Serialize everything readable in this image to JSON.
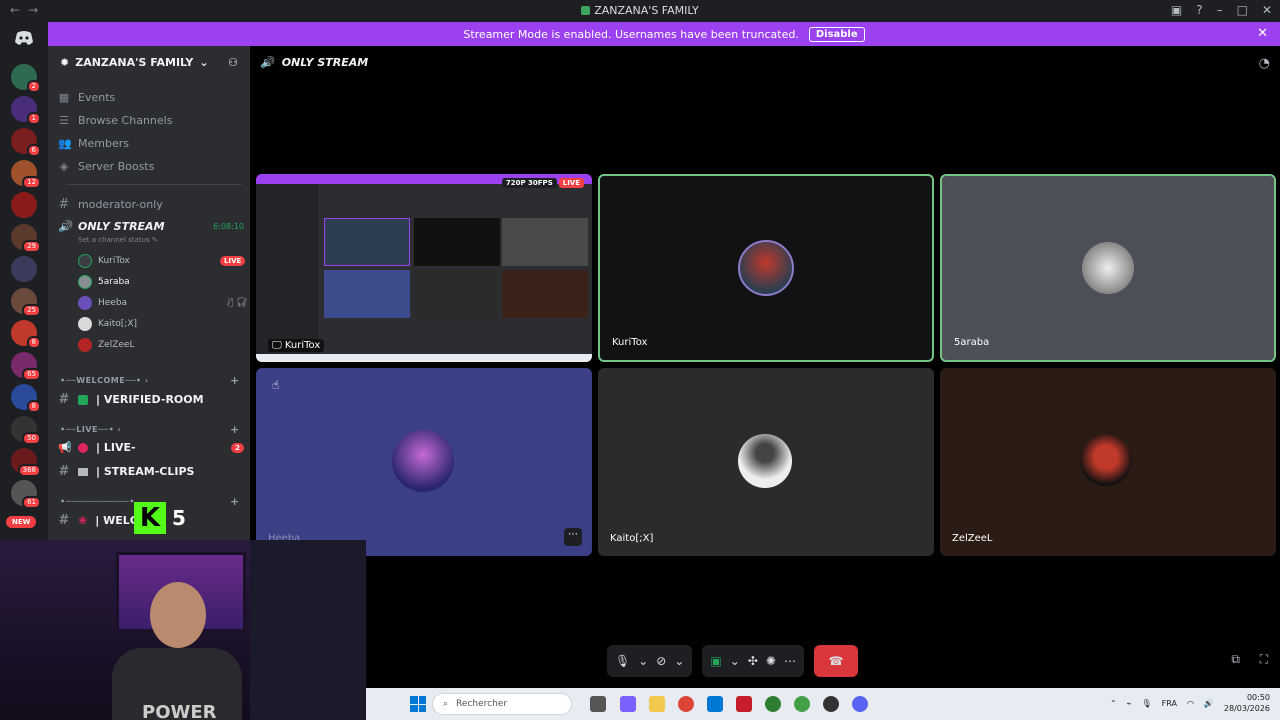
{
  "window": {
    "title": "ZANZANA'S FAMILY",
    "nav_back": "←",
    "nav_fwd": "→"
  },
  "banner": {
    "text": "Streamer Mode is enabled. Usernames have been truncated.",
    "disable_label": "Disable"
  },
  "guilds": {
    "badges": [
      "2",
      "1",
      "6",
      "12",
      "",
      "29",
      "",
      "25",
      "8",
      "65",
      "8",
      "50",
      "368",
      "61"
    ],
    "new_label": "NEW"
  },
  "server": {
    "name": "ZANZANA'S FAMILY",
    "menu": [
      {
        "label": "Events",
        "icon": "calendar-icon"
      },
      {
        "label": "Browse Channels",
        "icon": "browse-icon"
      },
      {
        "label": "Members",
        "icon": "members-icon"
      },
      {
        "label": "Server Boosts",
        "icon": "boost-icon"
      }
    ],
    "channels": {
      "moderator": "moderator-only",
      "voice_name": "ONLY STREAM",
      "voice_timer": "6:08:10",
      "voice_status": "Set a channel status",
      "voice_users": [
        {
          "name": "KuriTox",
          "live": "LIVE"
        },
        {
          "name": "5araba",
          "live": ""
        },
        {
          "name": "Heeba",
          "live": ""
        },
        {
          "name": "Kaito[;X]",
          "live": ""
        },
        {
          "name": "ZelZeeL",
          "live": ""
        }
      ],
      "cat_welcome": "•──WELCOME──•",
      "verified_room": "| VERIFIED-ROOM",
      "cat_live": "•──LIVE──•",
      "live_channel": "| LIVE-",
      "live_badge": "2",
      "stream_clips": "| STREAM-CLIPS",
      "cat_third": "•────────────•",
      "welcome_channel": "| WELC"
    }
  },
  "main": {
    "header": "ONLY STREAM",
    "stream_badges": {
      "quality": "720P 30FPS",
      "live": "LIVE"
    },
    "tiles": [
      {
        "name": "KuriTox"
      },
      {
        "name": "KuriTox"
      },
      {
        "name": "5araba"
      },
      {
        "name": "Heeba"
      },
      {
        "name": "Kaito[;X]"
      },
      {
        "name": "ZelZeeL"
      }
    ]
  },
  "overlay": {
    "k_badge": "K",
    "k_count": "5",
    "shirt_text": "POWER"
  },
  "taskbar": {
    "search_placeholder": "Rechercher",
    "lang": "FRA",
    "time": "00:50",
    "date": "28/03/2026"
  },
  "colors": {
    "accent": "#9c41f0",
    "live": "#f23f43",
    "online": "#23a55a",
    "sidebar": "#2b2d31",
    "rail": "#1e1f22",
    "hangup": "#da373c",
    "kick": "#53fc18"
  }
}
